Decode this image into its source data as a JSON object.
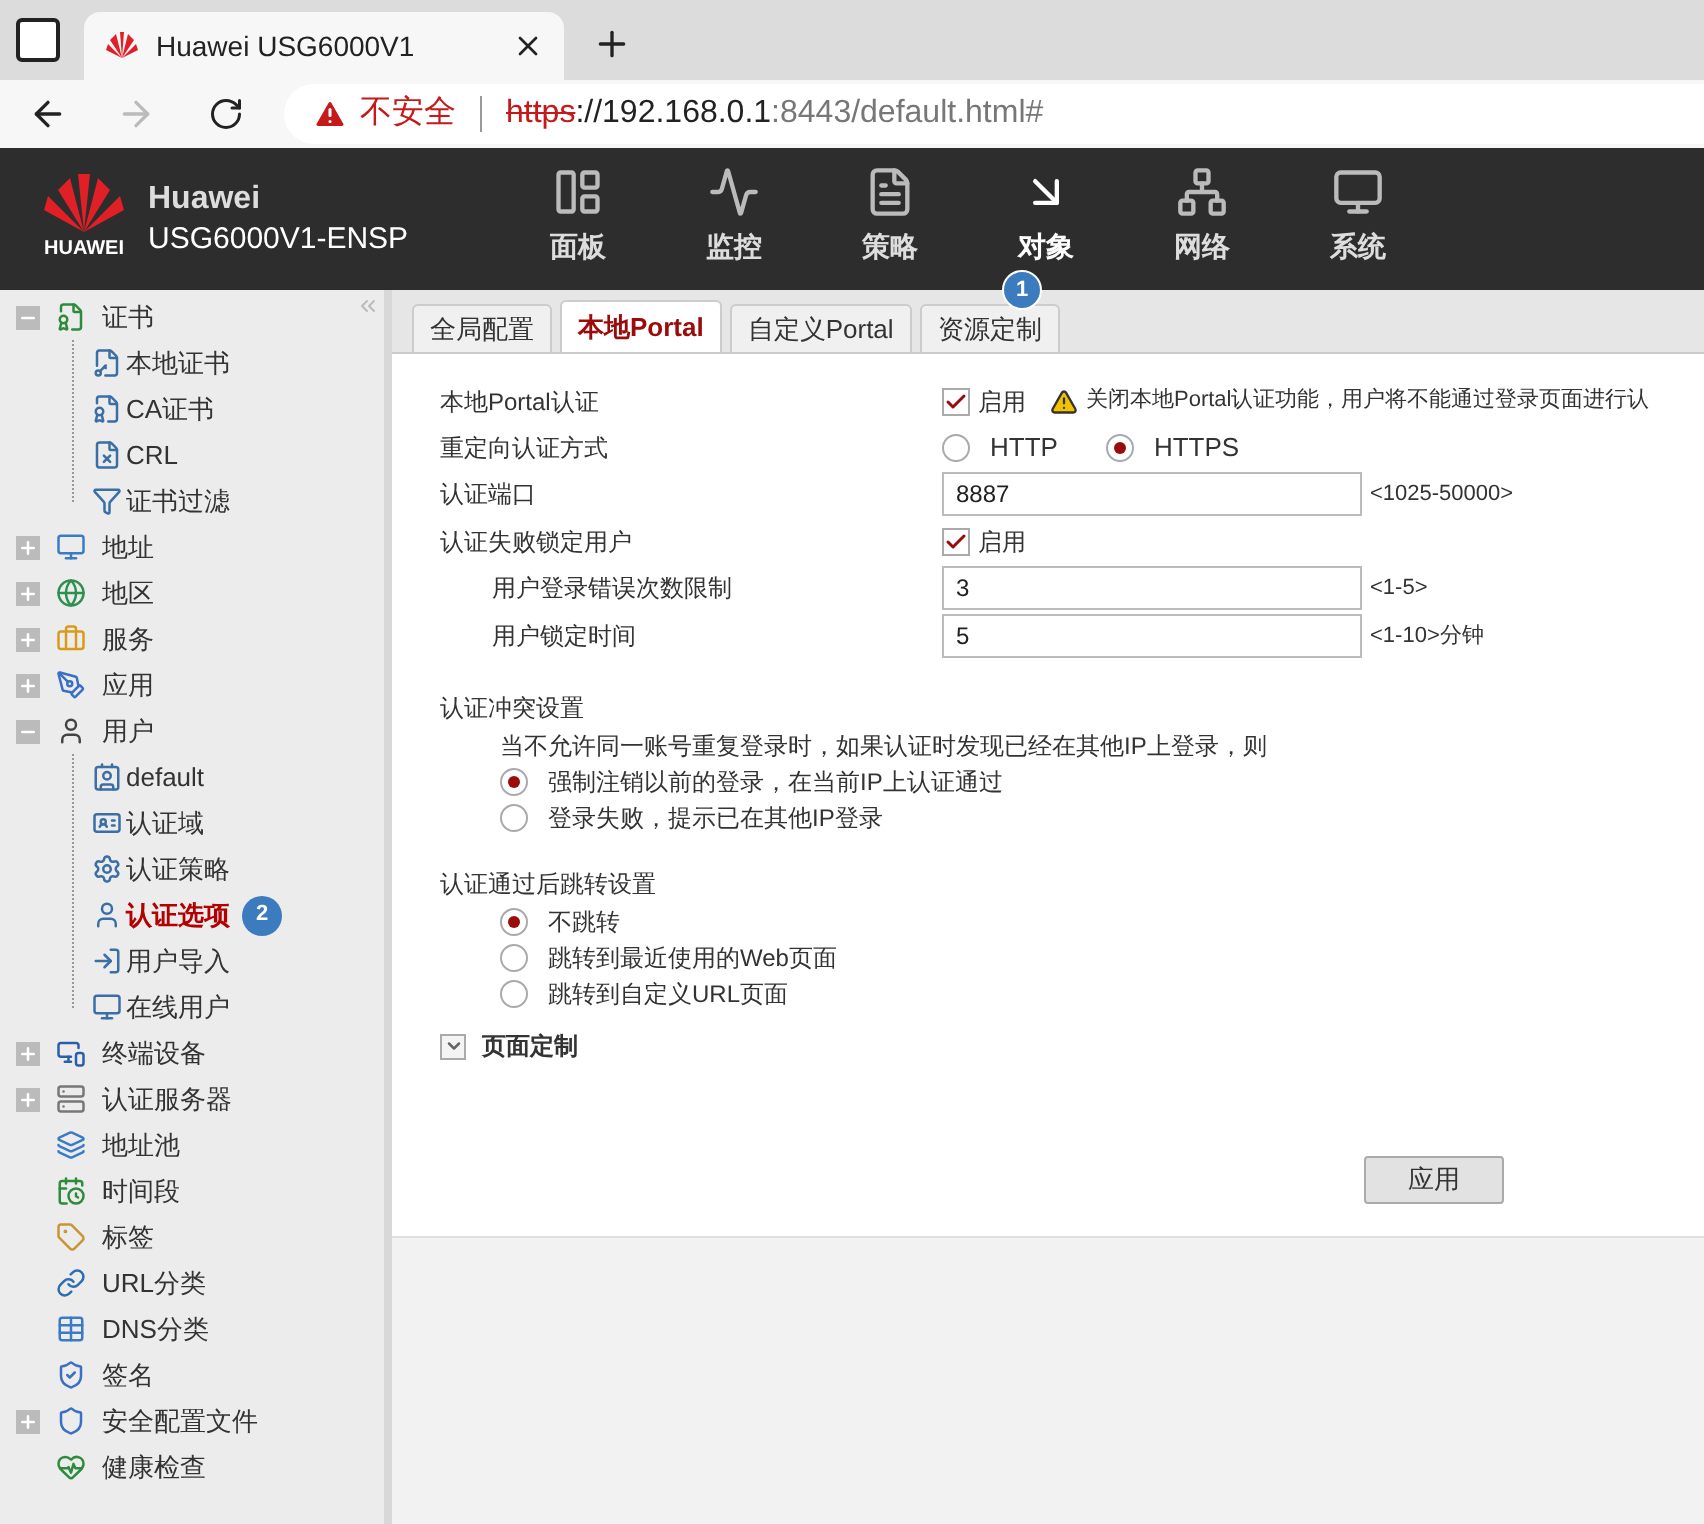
{
  "browser": {
    "tab_title": "Huawei USG6000V1",
    "security_label": "不安全",
    "url_scheme": "https",
    "url_host": "://192.168.0.1",
    "url_rest": ":8443/default.html#"
  },
  "header": {
    "brand": "Huawei",
    "model": "USG6000V1-ENSP",
    "logo_text": "HUAWEI",
    "nav": [
      {
        "label": "面板",
        "selected": false
      },
      {
        "label": "监控",
        "selected": false
      },
      {
        "label": "策略",
        "selected": false
      },
      {
        "label": "对象",
        "selected": true,
        "badge": "1"
      },
      {
        "label": "网络",
        "selected": false
      },
      {
        "label": "系统",
        "selected": false
      }
    ]
  },
  "sidebar": {
    "items": [
      {
        "label": "证书",
        "expanded": true,
        "selected": false,
        "children": [
          {
            "label": "本地证书",
            "selected": false
          },
          {
            "label": "CA证书",
            "selected": false
          },
          {
            "label": "CRL",
            "selected": false
          },
          {
            "label": "证书过滤",
            "selected": false
          }
        ]
      },
      {
        "label": "地址",
        "expanded": false,
        "selected": false
      },
      {
        "label": "地区",
        "expanded": false,
        "selected": false
      },
      {
        "label": "服务",
        "expanded": false,
        "selected": false
      },
      {
        "label": "应用",
        "expanded": false,
        "selected": false
      },
      {
        "label": "用户",
        "expanded": true,
        "selected": false,
        "children": [
          {
            "label": "default",
            "selected": false
          },
          {
            "label": "认证域",
            "selected": false
          },
          {
            "label": "认证策略",
            "selected": false
          },
          {
            "label": "认证选项",
            "selected": true,
            "badge": "2"
          },
          {
            "label": "用户导入",
            "selected": false
          },
          {
            "label": "在线用户",
            "selected": false
          }
        ]
      },
      {
        "label": "终端设备",
        "expanded": false,
        "selected": false
      },
      {
        "label": "认证服务器",
        "expanded": false,
        "selected": false
      },
      {
        "label": "地址池",
        "selected": false
      },
      {
        "label": "时间段",
        "selected": false
      },
      {
        "label": "标签",
        "selected": false
      },
      {
        "label": "URL分类",
        "selected": false
      },
      {
        "label": "DNS分类",
        "selected": false
      },
      {
        "label": "签名",
        "selected": false
      },
      {
        "label": "安全配置文件",
        "expanded": false,
        "selected": false
      },
      {
        "label": "健康检查",
        "selected": false
      }
    ]
  },
  "tabs": [
    {
      "label": "全局配置",
      "selected": false
    },
    {
      "label": "本地Portal",
      "selected": true
    },
    {
      "label": "自定义Portal",
      "selected": false
    },
    {
      "label": "资源定制",
      "selected": false
    }
  ],
  "form": [
    {
      "kind": "checkbox",
      "label": "本地Portal认证",
      "checked": true,
      "text": "启用",
      "warning": "关闭本地Portal认证功能，用户将不能通过登录页面进行认"
    },
    {
      "kind": "radios",
      "label": "重定向认证方式",
      "options": [
        {
          "label": "HTTP",
          "selected": false
        },
        {
          "label": "HTTPS",
          "selected": true
        }
      ]
    },
    {
      "kind": "input",
      "label": "认证端口",
      "value": "8887",
      "hint": "<1025-50000>"
    },
    {
      "kind": "checkbox",
      "label": "认证失败锁定用户",
      "checked": true,
      "text": "启用",
      "children": [
        {
          "kind": "input",
          "label": "用户登录错误次数限制",
          "value": "3",
          "hint": "<1-5>"
        },
        {
          "kind": "input",
          "label": "用户锁定时间",
          "value": "5",
          "hint": "<1-10>分钟"
        }
      ]
    }
  ],
  "sections": [
    {
      "title": "认证冲突设置",
      "note": "当不允许同一账号重复登录时，如果认证时发现已经在其他IP上登录，则",
      "options": [
        {
          "label": "强制注销以前的登录，在当前IP上认证通过",
          "selected": true
        },
        {
          "label": "登录失败，提示已在其他IP登录",
          "selected": false
        }
      ]
    },
    {
      "title": "认证通过后跳转设置",
      "options": [
        {
          "label": "不跳转",
          "selected": true
        },
        {
          "label": "跳转到最近使用的Web页面",
          "selected": false
        },
        {
          "label": "跳转到自定义URL页面",
          "selected": false
        }
      ]
    }
  ],
  "collapsible": {
    "label": "页面定制",
    "expanded": false
  },
  "apply_button": "应用"
}
